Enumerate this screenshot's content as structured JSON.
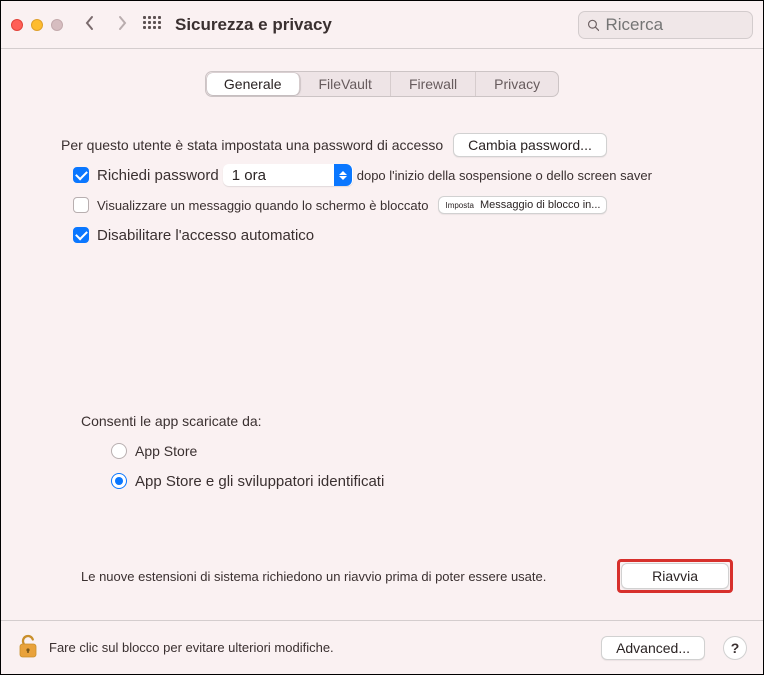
{
  "window": {
    "title": "Sicurezza e privacy",
    "search_placeholder": "Ricerca"
  },
  "tabs": {
    "general": "Generale",
    "filevault": "FileVault",
    "firewall": "Firewall",
    "privacy": "Privacy",
    "active": "general"
  },
  "login": {
    "prefix": "Per questo utente è stata impostata una password di accesso",
    "change_password_btn": "Cambia password...",
    "require_password_label": "Richiedi password",
    "require_password_value": "1 ora",
    "require_password_suffix": "dopo l'inizio della sospensione o dello screen saver",
    "show_message_label": "Visualizzare un messaggio quando lo schermo è bloccato",
    "set_lock_message_btn_prefix": "Imposta",
    "set_lock_message_btn": "Messaggio di blocco in...",
    "disable_auto_login_label": "Disabilitare l'accesso automatico"
  },
  "downloads": {
    "heading": "Consenti le app scaricate da:",
    "option_appstore": "App Store",
    "option_identified": "App Store e gli sviluppatori identificati",
    "selected": "identified"
  },
  "restart": {
    "message": "Le nuove estensioni di sistema richiedono un riavvio prima di poter essere usate.",
    "button": "Riavvia"
  },
  "footer": {
    "lock_hint": "Fare clic sul blocco per evitare ulteriori modifiche.",
    "advanced_btn": "Advanced...",
    "help": "?"
  }
}
